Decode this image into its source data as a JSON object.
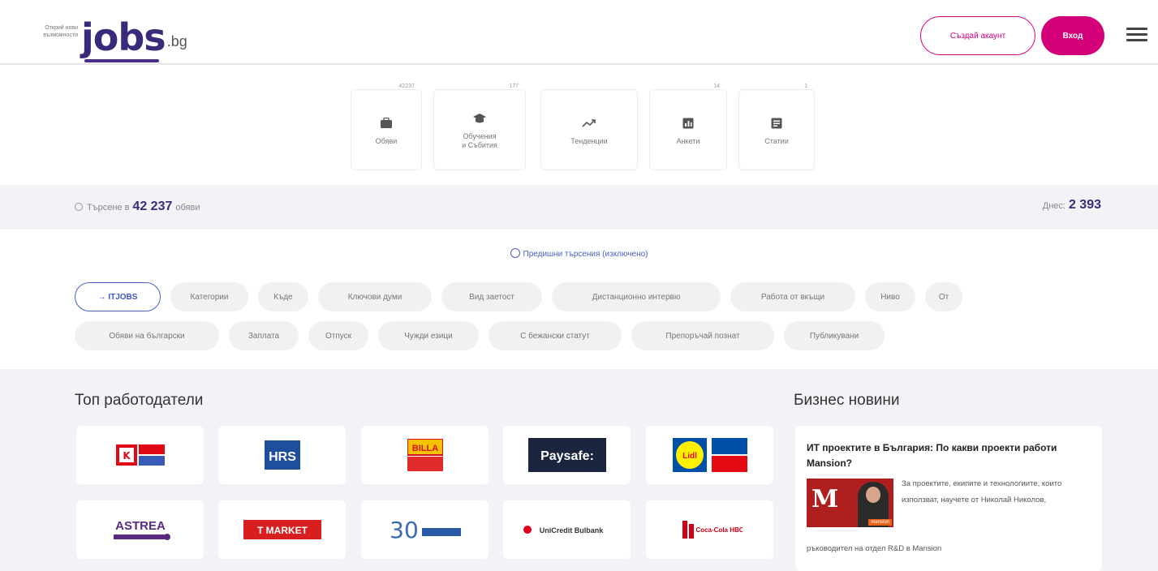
{
  "header": {
    "logo_tagline": "Открий нови възможности",
    "logo_main": "jobs",
    "logo_suffix": ".bg",
    "create_account_label": "Създай акаунт",
    "login_label": "Вход",
    "menu_icon": "hamburger-icon"
  },
  "categories": [
    {
      "label": "Обяви",
      "count": "42237",
      "icon": "briefcase-icon"
    },
    {
      "label": "Обучения\nи Събития",
      "count": "177",
      "icon": "graduation-cap-icon"
    },
    {
      "label": "Тенденции",
      "count": "",
      "icon": "trend-icon"
    },
    {
      "label": "Анкети",
      "count": "14",
      "icon": "poll-icon"
    },
    {
      "label": "Статии",
      "count": "1",
      "icon": "article-icon"
    }
  ],
  "search": {
    "prefix": "Търсене в",
    "count": "42 237",
    "suffix": "обяви",
    "today_label": "Днес:",
    "today_count": "2 393",
    "previous_searches": "Предишни търсения (изключено)"
  },
  "filters": {
    "row1": [
      "→ ITJOBS",
      "Категории",
      "Къде",
      "Ключови думи",
      "Вид заетост",
      "Дистанционно интервю",
      "Работа от вкъщи",
      "Ниво",
      "От"
    ],
    "row2": [
      "Обяви на български",
      "Заплата",
      "Отпуск",
      "Чужди езици",
      "С бежански статут",
      "Препоръчай познат",
      "Публикувани"
    ]
  },
  "top_employers": {
    "title": "Топ работодатели",
    "logos": [
      {
        "name": "Kaufland",
        "text": "K"
      },
      {
        "name": "HRS",
        "text": "HRS"
      },
      {
        "name": "BILLA",
        "text": "BILLA"
      },
      {
        "name": "Paysafe",
        "text": "Paysafe:"
      },
      {
        "name": "Lidl",
        "text": "Lidl"
      },
      {
        "name": "Astrea",
        "text": "ASTREA"
      },
      {
        "name": "T MARKET",
        "text": "T MARKET"
      },
      {
        "name": "30 years",
        "text": "30"
      },
      {
        "name": "UniCredit Bulbank",
        "text": "UniCredit Bulbank"
      },
      {
        "name": "Coca-Cola HBC",
        "text": "Coca-Cola HBC"
      }
    ]
  },
  "business_news": {
    "title": "Бизнес новини",
    "article_title": "ИТ проектите в България: По какви проекти работи Mansion?",
    "excerpt_right": "За проектите, екипите и технологиите, които използват, научете от Николай Николов,",
    "excerpt_bottom": "ръководител на отдел R&D в Mansion",
    "image_tag": "mansion"
  },
  "colors": {
    "brand_purple": "#3b2a7a",
    "accent_magenta": "#d4007a",
    "link_blue": "#4a5fc1",
    "band_gray": "#f2f3f7"
  }
}
